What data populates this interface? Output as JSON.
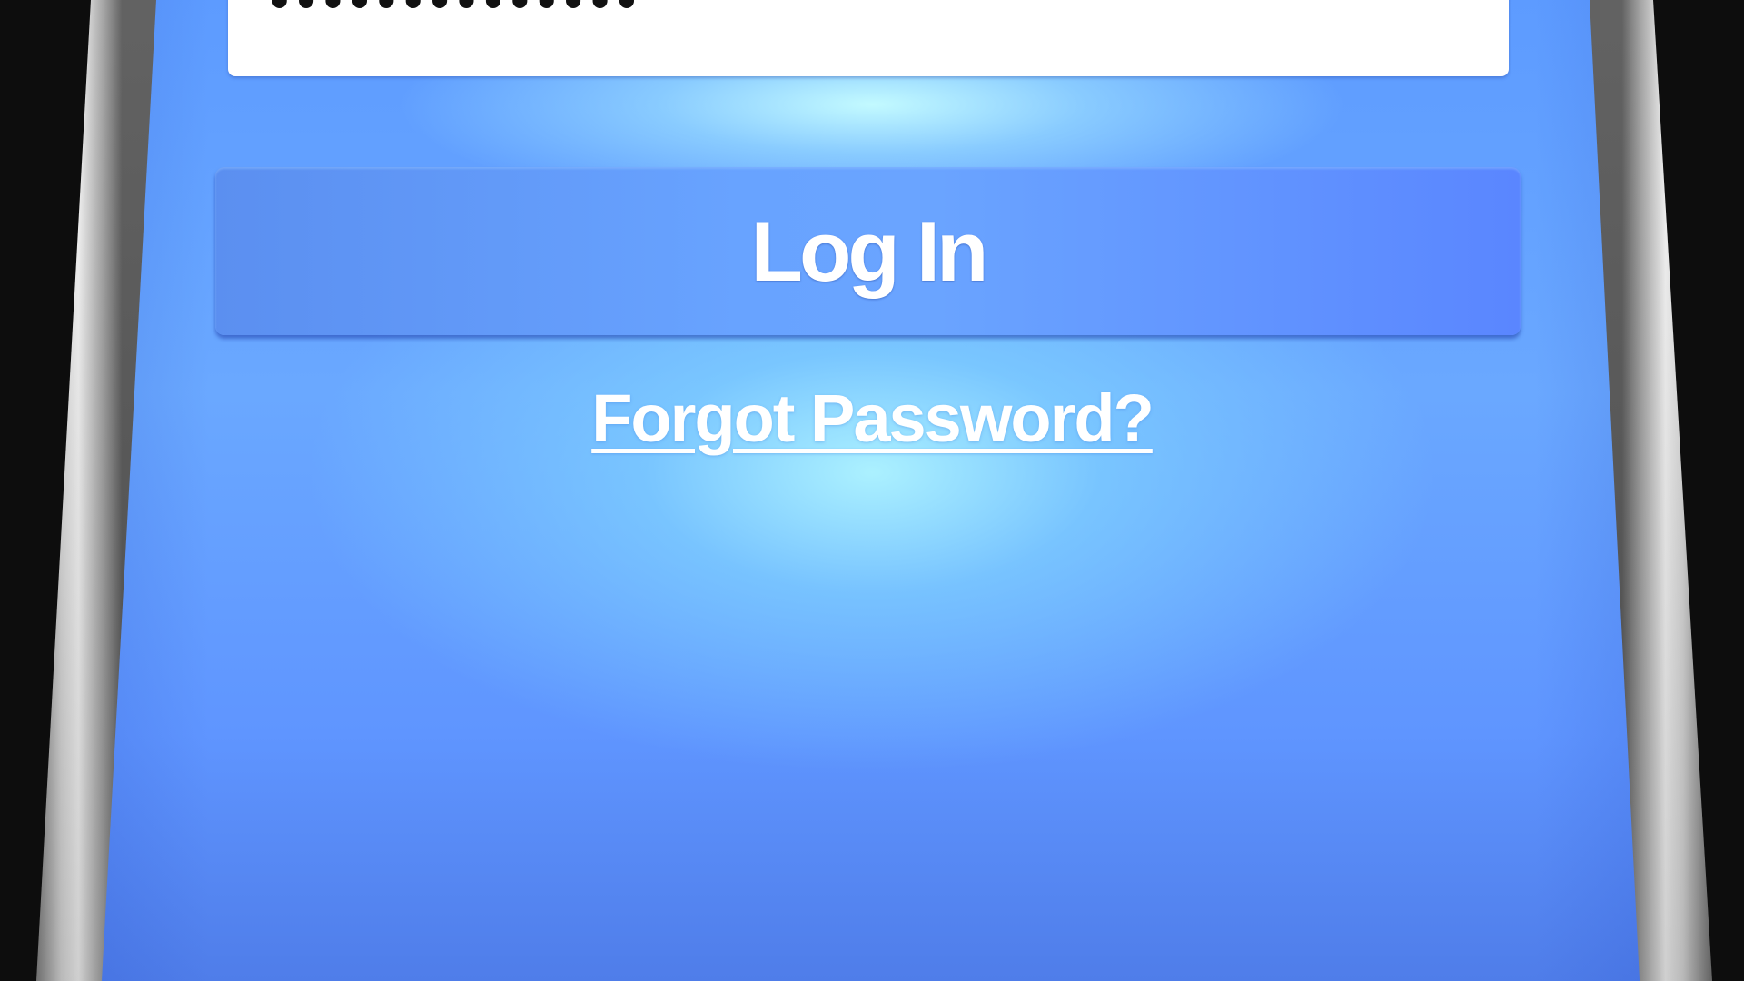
{
  "login_form": {
    "password": {
      "value": "••••••••••••••"
    },
    "login_button": {
      "label": "Log In"
    },
    "forgot_password": {
      "label": "Forgot Password?"
    }
  },
  "colors": {
    "screen_blue": "#5d9bff",
    "button_blue": "#68a3ff",
    "field_background": "#ffffff",
    "link_text": "#ffffff"
  }
}
